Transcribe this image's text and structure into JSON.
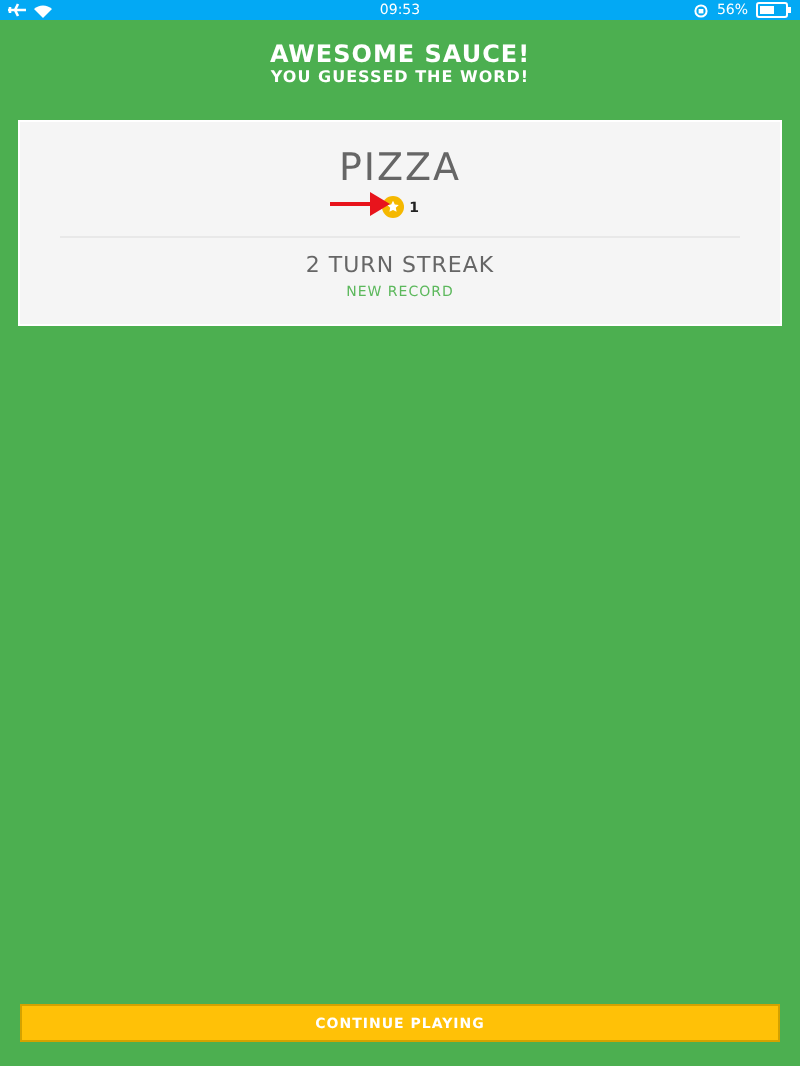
{
  "status_bar": {
    "time": "09:53",
    "battery": "56%"
  },
  "header": {
    "title": "AWESOME SAUCE!",
    "subtitle": "YOU GUESSED THE WORD!"
  },
  "result_card": {
    "word": "PIZZA",
    "coins": "1",
    "streak": "2 TURN STREAK",
    "record": "NEW RECORD"
  },
  "buttons": [
    "CONTINUE PLAYING"
  ]
}
